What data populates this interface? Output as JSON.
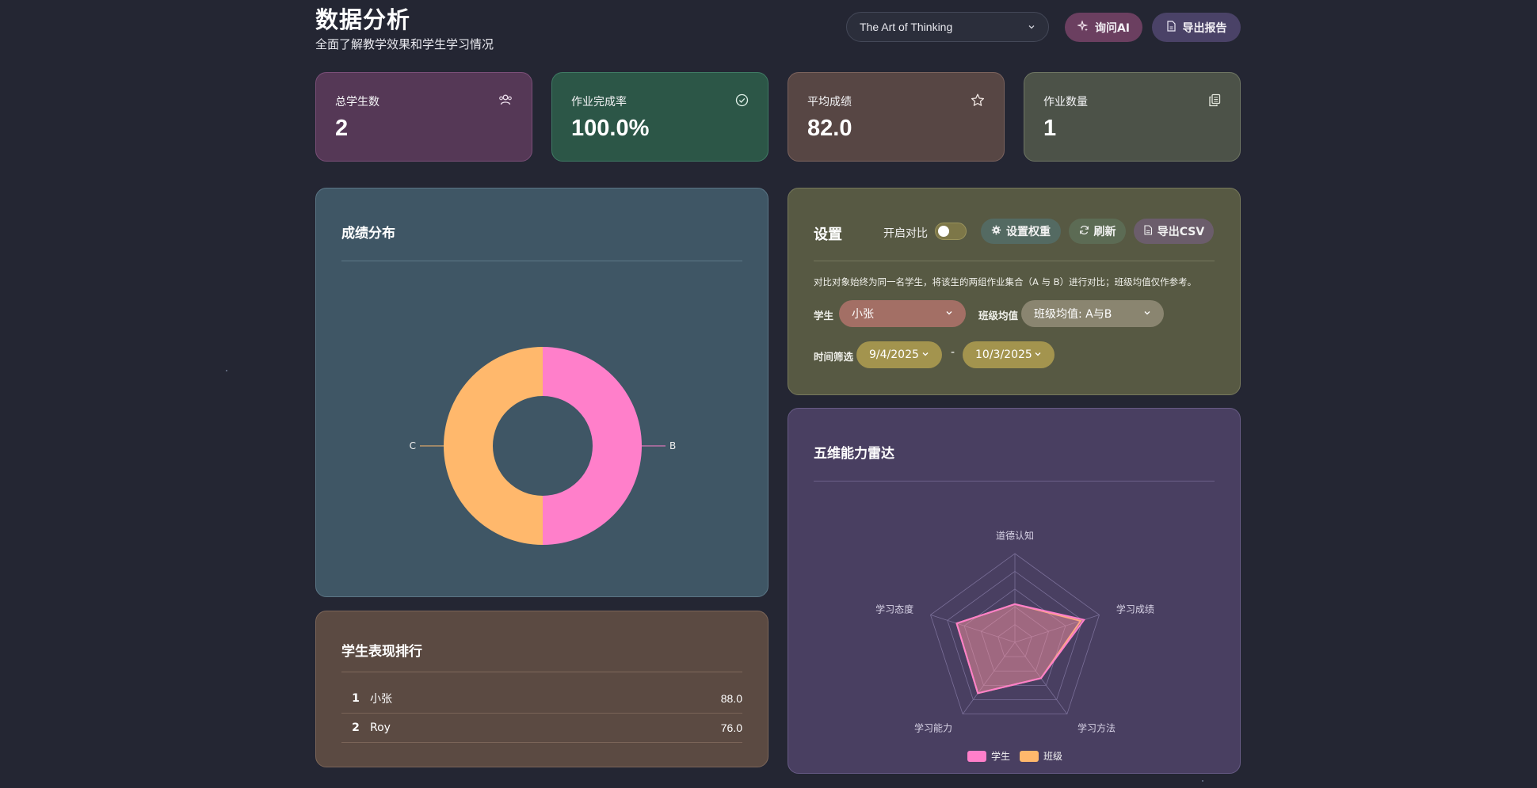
{
  "header": {
    "title": "数据分析",
    "subtitle": "全面了解教学效果和学生学习情况",
    "course_select": "The Art of Thinking",
    "ask_ai": "询问AI",
    "export_report": "导出报告"
  },
  "stats": [
    {
      "label": "总学生数",
      "value": "2",
      "icon": "users-icon"
    },
    {
      "label": "作业完成率",
      "value": "100.0%",
      "icon": "check-circle-icon"
    },
    {
      "label": "平均成绩",
      "value": "82.0",
      "icon": "star-icon"
    },
    {
      "label": "作业数量",
      "value": "1",
      "icon": "copy-icon"
    }
  ],
  "grade_distribution": {
    "title": "成绩分布",
    "chart_data": {
      "type": "pie",
      "categories": [
        "B",
        "C"
      ],
      "values": [
        1,
        1
      ],
      "colors": [
        "#ff7fca",
        "#ffb86c"
      ]
    }
  },
  "ranking": {
    "title": "学生表现排行",
    "rows": [
      {
        "rank": "1",
        "name": "小张",
        "score": "88.0"
      },
      {
        "rank": "2",
        "name": "Roy",
        "score": "76.0"
      }
    ]
  },
  "settings": {
    "title": "设置",
    "compare_label": "开启对比",
    "compare_on": false,
    "weights_btn": "设置权重",
    "refresh_btn": "刷新",
    "csv_btn": "导出CSV",
    "description": "对比对象始终为同一名学生，将该生的两组作业集合（A 与 B）进行对比；班级均值仅作参考。",
    "student_label": "学生",
    "student_value": "小张",
    "avg_label": "班级均值",
    "avg_value": "班级均值: A与B",
    "time_label": "时间筛选",
    "start_date": "9/4/2025",
    "date_separator": "-",
    "end_date": "10/3/2025"
  },
  "radar": {
    "title": "五维能力雷达",
    "chart_data": {
      "type": "radar",
      "axes": [
        "道德认知",
        "学习成绩",
        "学习方法",
        "学习能力",
        "学习态度"
      ],
      "max": 100,
      "series": [
        {
          "name": "学生",
          "values": [
            43,
            82,
            50,
            71,
            69
          ],
          "color": "#ff7fca"
        },
        {
          "name": "班级",
          "values": [
            43,
            78,
            50,
            71,
            69
          ],
          "color": "#ffb86c"
        }
      ]
    }
  }
}
